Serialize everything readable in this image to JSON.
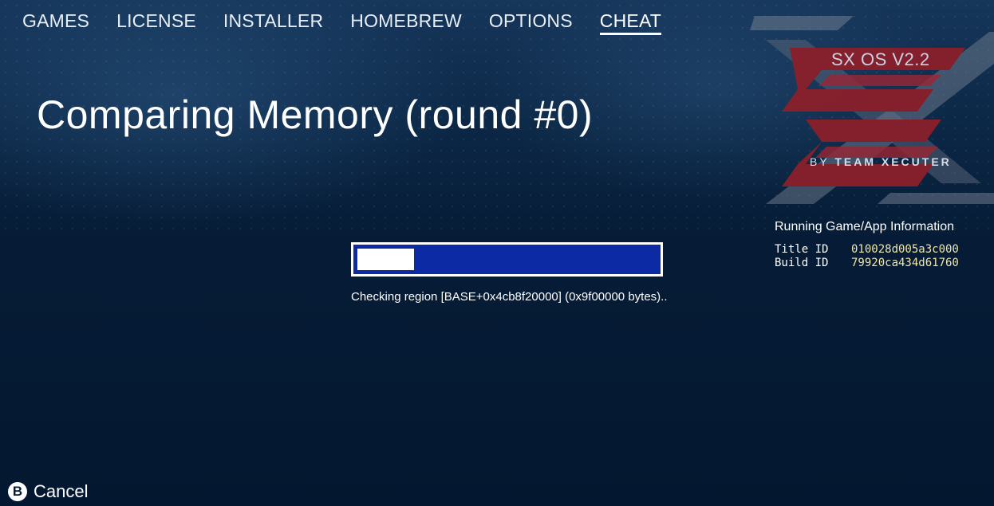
{
  "nav": {
    "tabs": [
      {
        "label": "GAMES"
      },
      {
        "label": "LICENSE"
      },
      {
        "label": "INSTALLER"
      },
      {
        "label": "HOMEBREW"
      },
      {
        "label": "OPTIONS"
      },
      {
        "label": "CHEAT",
        "active": true
      }
    ]
  },
  "main": {
    "title": "Comparing Memory (round #0)",
    "progress": {
      "fraction": 0.19,
      "status_text": "Checking region [BASE+0x4cb8f20000] (0x9f00000 bytes).."
    }
  },
  "logo": {
    "version": "SX OS V2.2",
    "byline_prefix": "BY",
    "byline_brand": "TEAM XECUTER",
    "icon": "sx-logo-icon"
  },
  "running_info": {
    "heading": "Running Game/App Information",
    "title_id_label": "Title ID",
    "title_id_value": "010028d005a3c000",
    "build_id_label": "Build ID",
    "build_id_value": "79920ca434d61760"
  },
  "footer": {
    "button_glyph": "B",
    "cancel_label": "Cancel"
  },
  "colors": {
    "background": "#061c36",
    "progress_track": "#0b2aa3",
    "progress_fill": "#ffffff",
    "id_value": "#f1e6a8",
    "logo_red": "#8b1f2b"
  }
}
